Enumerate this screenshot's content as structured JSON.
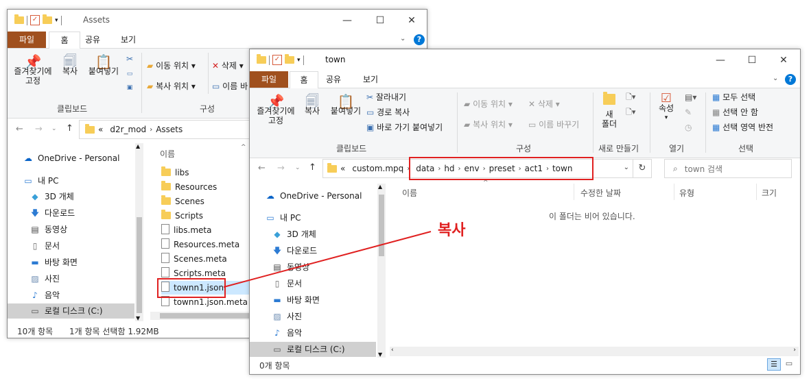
{
  "window1": {
    "title": "Assets",
    "tabs": [
      "파일",
      "홈",
      "공유",
      "보기"
    ],
    "ribbon": {
      "pin_label": "즐겨찾기에\n고정",
      "copy_label": "복사",
      "paste_label": "붙여넣기",
      "move_to": "이동 위치",
      "copy_to": "복사 위치",
      "delete": "삭제",
      "rename": "이름 바",
      "group_clipboard": "클립보드",
      "group_organize": "구성"
    },
    "breadcrumb": {
      "prefix": "«",
      "parts": [
        "d2r_mod",
        "Assets"
      ]
    },
    "nav": [
      "OneDrive - Personal",
      "내 PC",
      "3D 개체",
      "다운로드",
      "동영상",
      "문서",
      "바탕 화면",
      "사진",
      "음악",
      "로컬 디스크 (C:)"
    ],
    "column_name": "이름",
    "files": [
      "libs",
      "Resources",
      "Scenes",
      "Scripts",
      "libs.meta",
      "Resources.meta",
      "Scenes.meta",
      "Scripts.meta",
      "townn1.json",
      "townn1.json.meta"
    ],
    "status_count": "10개 항목",
    "status_selected": "1개 항목 선택함 1.92MB"
  },
  "window2": {
    "title": "town",
    "tabs": [
      "파일",
      "홈",
      "공유",
      "보기"
    ],
    "ribbon": {
      "pin_label": "즐겨찾기에\n고정",
      "copy_label": "복사",
      "paste_label": "붙여넣기",
      "cut": "잘라내기",
      "copy_path": "경로 복사",
      "paste_shortcut": "바로 가기 붙여넣기",
      "move_to": "이동 위치",
      "copy_to": "복사 위치",
      "delete": "삭제",
      "rename": "이름 바꾸기",
      "new_folder": "새\n폴더",
      "properties": "속성",
      "select_all": "모두 선택",
      "select_none": "선택 안 함",
      "invert_selection": "선택 영역 반전",
      "group_clipboard": "클립보드",
      "group_organize": "구성",
      "group_new": "새로 만들기",
      "group_open": "열기",
      "group_select": "선택"
    },
    "breadcrumb": {
      "prefix": "«",
      "root": "custom.mpq",
      "parts": [
        "data",
        "hd",
        "env",
        "preset",
        "act1",
        "town"
      ]
    },
    "search_placeholder": "town 검색",
    "nav": [
      "OneDrive - Personal",
      "내 PC",
      "3D 개체",
      "다운로드",
      "동영상",
      "문서",
      "바탕 화면",
      "사진",
      "음악",
      "로컬 디스크 (C:)"
    ],
    "columns": [
      "이름",
      "수정한 날짜",
      "유형",
      "크기"
    ],
    "empty_message": "이 폴더는 비어 있습니다.",
    "status_count": "0개 항목"
  },
  "annotation": {
    "label": "복사",
    "color": "#e02020"
  },
  "colors": {
    "file_tab": "#a0501e",
    "accent": "#0078d7",
    "folder": "#f7cd58"
  }
}
